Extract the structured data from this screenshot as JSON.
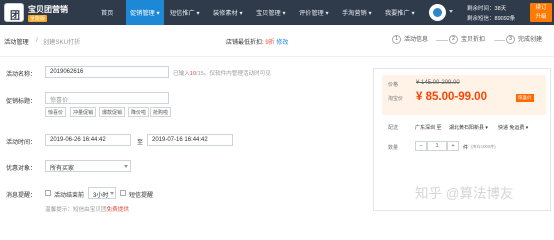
{
  "app": {
    "name": "宝贝团营销",
    "edition": "全能版"
  },
  "nav": {
    "items": [
      {
        "label": "首页"
      },
      {
        "label": "促销管理 ▾"
      },
      {
        "label": "短信推广 ▾"
      },
      {
        "label": "装修素材 ▾"
      },
      {
        "label": "宝贝管理 ▾"
      },
      {
        "label": "评价管理 ▾"
      },
      {
        "label": "手淘营销 ▾"
      },
      {
        "label": "我要推广 ▾"
      }
    ],
    "active_index": 1
  },
  "account": {
    "days_label": "剩余时间：",
    "days_value": "38天",
    "sms_label": "剩余短信：",
    "sms_value": "89092条",
    "renew_line1": "续订",
    "renew_line2": "升级"
  },
  "subheader": {
    "crumb_parent": "活动管理",
    "crumb_separator": "/",
    "crumb_current": "创建SKU打折",
    "store_rate_label": "店铺最低折扣:",
    "store_rate_value": "9折",
    "store_rate_modify": "修改",
    "steps": [
      {
        "num": "1",
        "label": "活动信息"
      },
      {
        "num": "2",
        "label": "宝贝折扣"
      },
      {
        "num": "3",
        "label": "完成创建"
      }
    ]
  },
  "form": {
    "name_label": "活动名称：",
    "name_value": "2019062616",
    "name_hint_prefix": "已输入",
    "name_hint_count": "10",
    "name_hint_suffix": "/15。仅软件内管理活动时可见",
    "promo_label": "促销标题：",
    "promo_placeholder": "惊喜价",
    "promo_tags": [
      "惊喜价",
      "冲量促销",
      "爆款促销",
      "降价啦",
      "抢购啦"
    ],
    "time_label": "活动时间：",
    "start_time": "2019-06-26 16:44:42",
    "time_to": "至",
    "end_time": "2019-07-16 16:44:42",
    "audience_label": "优惠对象：",
    "audience_value": "所有买家",
    "notify_label": "消息提醒：",
    "notify_checkbox_label": "活动结束前",
    "notify_hours": "3小时",
    "notify_sms_label": "短信提醒",
    "notify_hint_prefix": "温馨提示：短信由宝贝团",
    "notify_hint_highlight": "免费提供"
  },
  "preview": {
    "price_label": "价格",
    "old_price": "¥ 145.00-209.00",
    "promo_price_label": "淘宝价",
    "promo_price": "¥ 85.00-99.00",
    "promo_badge": "惊喜价",
    "ship_label": "配送",
    "ship_from": "广东深圳 至",
    "ship_to": "湖北黄石阳新县 ▾",
    "ship_fee": "快递 免运费 ▾",
    "qty_label": "数量",
    "qty_minus": "−",
    "qty_value": "1",
    "qty_plus": "+",
    "qty_unit": "件",
    "qty_stock": "(库存1000件)"
  },
  "watermark": "知乎 @算法博友",
  "colors": {
    "nav_bg": "#2f3a4a",
    "nav_active": "#1d89d6",
    "price": "#ff4400",
    "warning": "#e84a3c"
  }
}
